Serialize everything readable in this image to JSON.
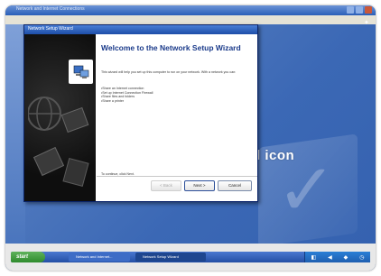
{
  "background_window": {
    "title": "Network and Internet Connections",
    "text_lines": [
      "",
      "",
      ""
    ],
    "big_text": "l icon"
  },
  "wizard": {
    "title": "Network Setup Wizard",
    "heading": "Welcome to the Network Setup Wizard",
    "description": "This wizard will help you set up this computer to run on your network. With a network you can:",
    "list_items": [
      "Share an Internet connection",
      "Set up Internet Connection Firewall",
      "Share files and folders",
      "Share a printer"
    ],
    "continue_text": "To continue, click Next.",
    "buttons": {
      "back": "< Back",
      "next": "Next >",
      "cancel": "Cancel"
    }
  },
  "taskbar": {
    "start_label": "start",
    "tasks": [
      {
        "label": "Network and Internet..."
      },
      {
        "label": "Network Setup Wizard"
      }
    ],
    "tray_icons": [
      "network-icon",
      "volume-icon",
      "shield-icon",
      "clock-icon"
    ]
  },
  "colors": {
    "desktop_blue": "#3b68b5",
    "title_blue": "#1d4ea8",
    "heading_blue": "#1a3a8a",
    "start_green": "#2f8b2d"
  }
}
